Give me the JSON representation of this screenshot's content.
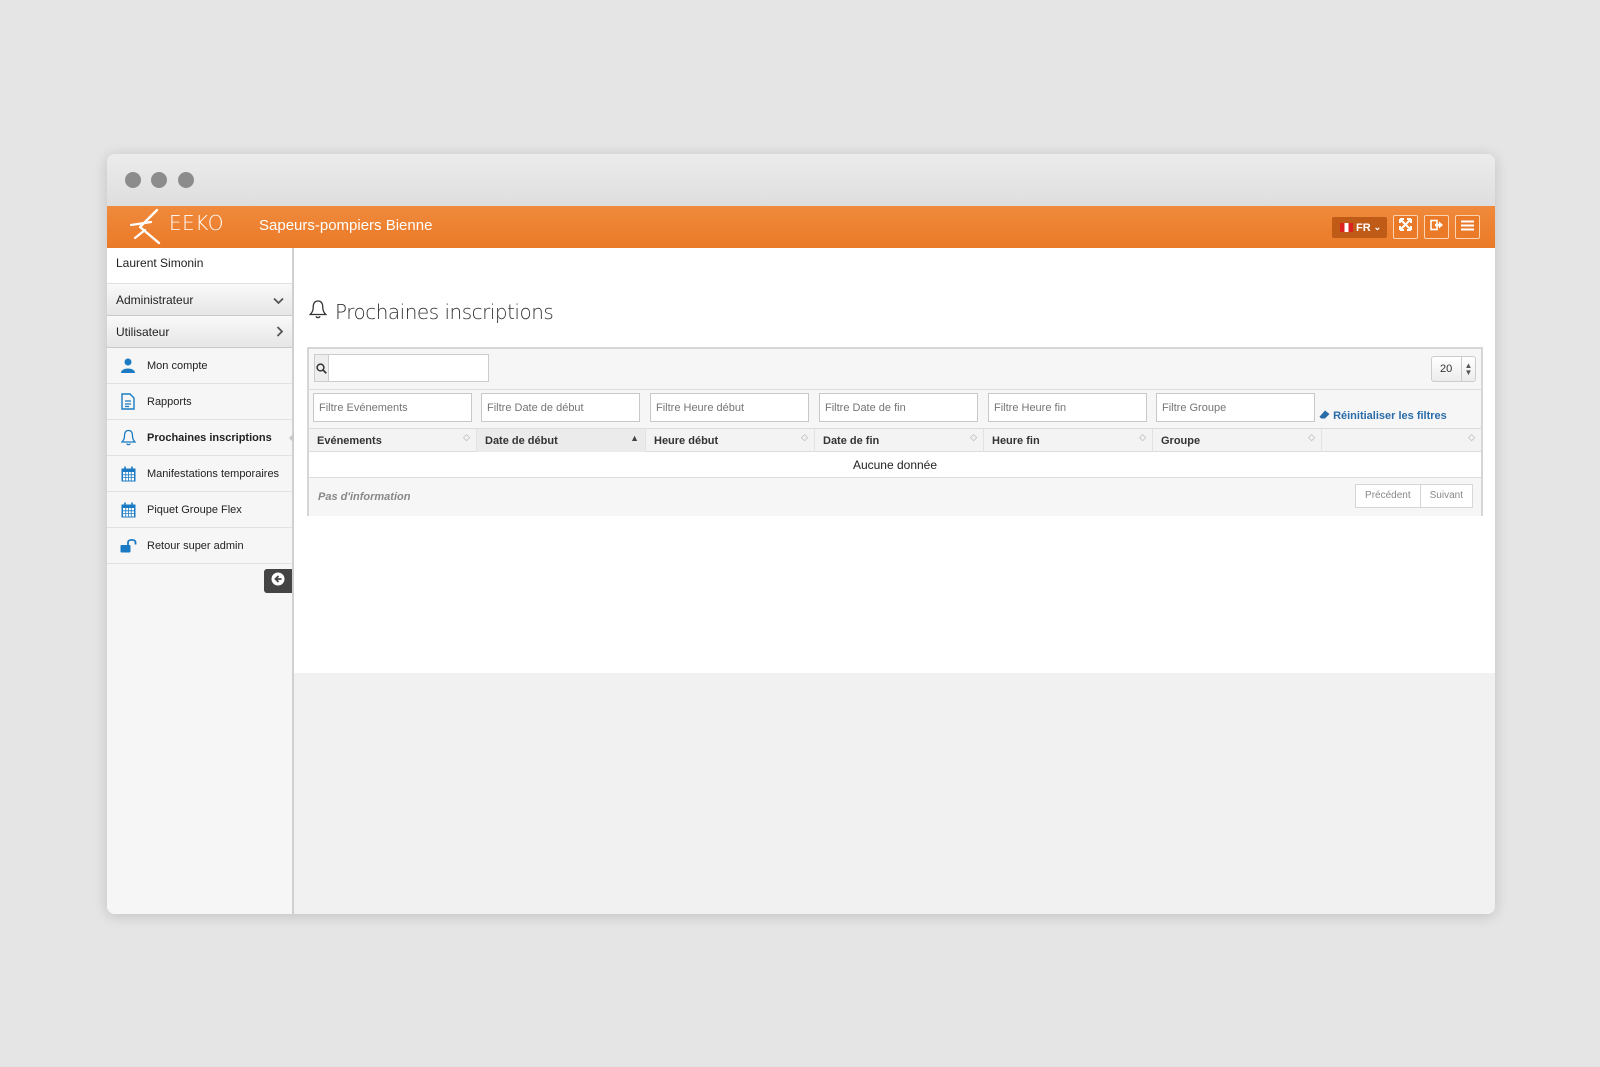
{
  "colors": {
    "brand_orange": "#ea7a28",
    "link_blue": "#2a6ca8",
    "icon_blue": "#1a7bc4"
  },
  "app": {
    "logo_text": "EEKO",
    "org_name": "Sapeurs-pompiers Bienne"
  },
  "topbar": {
    "lang_label": "FR",
    "lang_chevron": "⌄",
    "buttons": [
      {
        "icon": "fullscreen-icon"
      },
      {
        "icon": "logout-icon"
      },
      {
        "icon": "hamburger-menu-icon"
      }
    ]
  },
  "sidebar": {
    "user_name": "Laurent Simonin",
    "roles": [
      {
        "label": "Administrateur",
        "chevron": "⌄"
      },
      {
        "label": "Utilisateur",
        "chevron": "›"
      }
    ],
    "items": [
      {
        "label": "Mon compte",
        "icon": "user-icon"
      },
      {
        "label": "Rapports",
        "icon": "document-icon"
      },
      {
        "label": "Prochaines inscriptions",
        "icon": "bell-icon",
        "active": true
      },
      {
        "label": "Manifestations temporaires",
        "icon": "calendar-icon"
      },
      {
        "label": "Piquet Groupe Flex",
        "icon": "calendar-icon"
      },
      {
        "label": "Retour super admin",
        "icon": "unlock-icon"
      }
    ]
  },
  "main": {
    "title": "Prochaines inscriptions",
    "search": {
      "value": "",
      "placeholder": ""
    },
    "page_length": "20",
    "filters": [
      {
        "placeholder": "Filtre Evénements"
      },
      {
        "placeholder": "Filtre Date de début"
      },
      {
        "placeholder": "Filtre Heure début"
      },
      {
        "placeholder": "Filtre Date de fin"
      },
      {
        "placeholder": "Filtre Heure fin"
      },
      {
        "placeholder": "Filtre Groupe"
      }
    ],
    "reset_filters_label": "Réinitialiser les filtres",
    "columns": [
      "Evénements",
      "Date de début",
      "Heure début",
      "Date de fin",
      "Heure fin",
      "Groupe",
      ""
    ],
    "sorted_column": "Date de début",
    "empty_message": "Aucune donnée",
    "info": "Pas d'information",
    "pager": {
      "prev": "Précédent",
      "next": "Suivant"
    }
  }
}
